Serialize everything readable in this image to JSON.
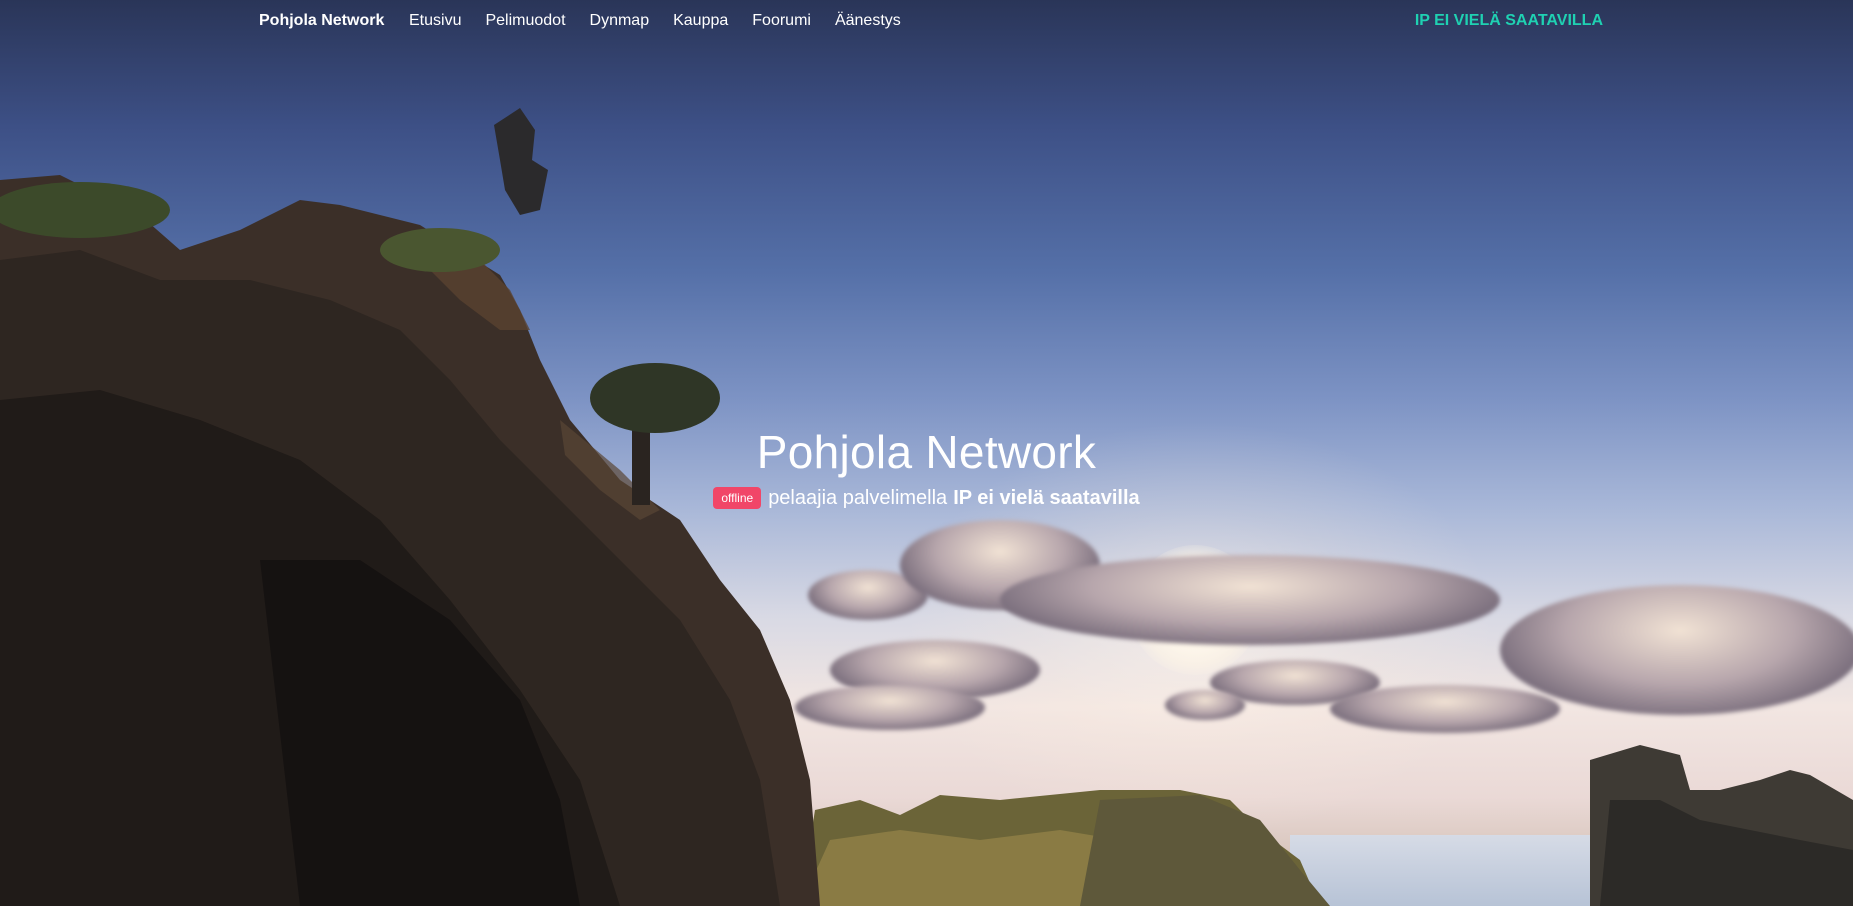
{
  "navbar": {
    "brand": "Pohjola Network",
    "links": [
      {
        "label": "Etusivu"
      },
      {
        "label": "Pelimuodot"
      },
      {
        "label": "Dynmap"
      },
      {
        "label": "Kauppa"
      },
      {
        "label": "Foorumi"
      },
      {
        "label": "Äänestys"
      }
    ],
    "ip_label": "IP EI VIELÄ SAATAVILLA",
    "ip_color": "#1fd1b2"
  },
  "hero": {
    "title": "Pohjola Network",
    "status_badge": "offline",
    "status_badge_color": "#f14668",
    "players_text": "pelaajia palvelimella",
    "ip_text": "IP ei vielä saatavilla"
  }
}
